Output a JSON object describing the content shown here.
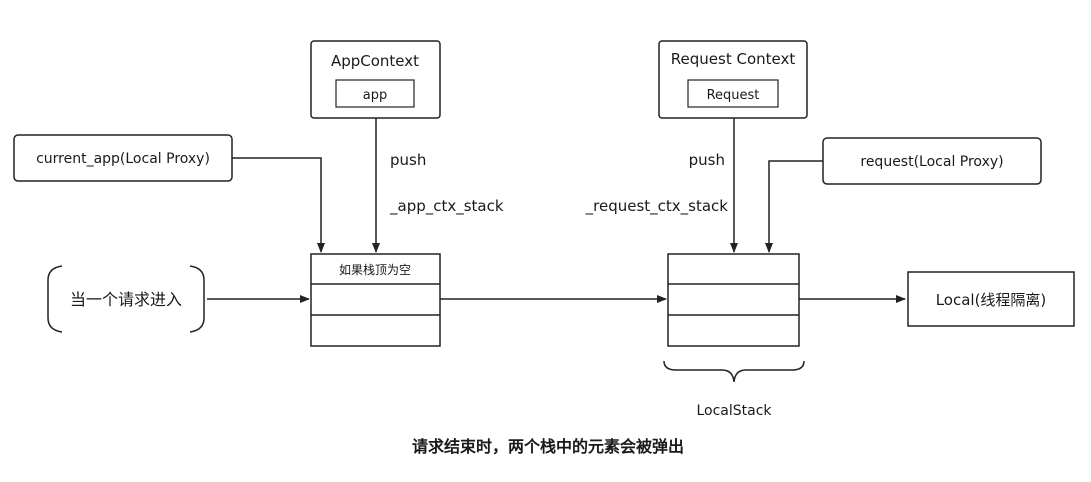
{
  "app_context": {
    "title": "AppContext",
    "inner": "app"
  },
  "request_context": {
    "title": "Request Context",
    "inner": "Request"
  },
  "current_app_proxy": "current_app(Local Proxy)",
  "request_proxy": "request(Local Proxy)",
  "app_push": "push",
  "app_stack_name": "_app_ctx_stack",
  "req_push": "push",
  "req_stack_name": "_request_ctx_stack",
  "request_entry": "当一个请求进入",
  "app_stack_top": "如果栈顶为空",
  "local_box": "Local(线程隔离)",
  "localstack_label": "LocalStack",
  "footer_note": "请求结束时，两个栈中的元素会被弹出"
}
